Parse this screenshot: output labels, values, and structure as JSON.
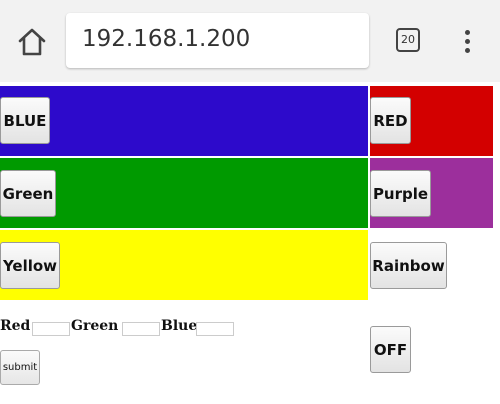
{
  "browser": {
    "url": "192.168.1.200",
    "tab_count": "20"
  },
  "buttons": {
    "blue": "BLUE",
    "red": "RED",
    "green": "Green",
    "purple": "Purple",
    "yellow": "Yellow",
    "rainbow": "Rainbow",
    "off": "OFF"
  },
  "colors": {
    "blue": "#2d0acb",
    "red": "#d30000",
    "green": "#009a00",
    "purple": "#9c2f9c",
    "yellow": "#ffff00",
    "chrome": "#f2f2f2"
  },
  "form": {
    "red_label": "Red",
    "green_label": "Green",
    "blue_label": "Blue",
    "red_value": "",
    "green_value": "",
    "blue_value": "",
    "submit_label": "submit"
  },
  "icons": {
    "home": "home-icon",
    "tabs": "tab-switcher-icon",
    "menu": "overflow-menu-icon"
  }
}
